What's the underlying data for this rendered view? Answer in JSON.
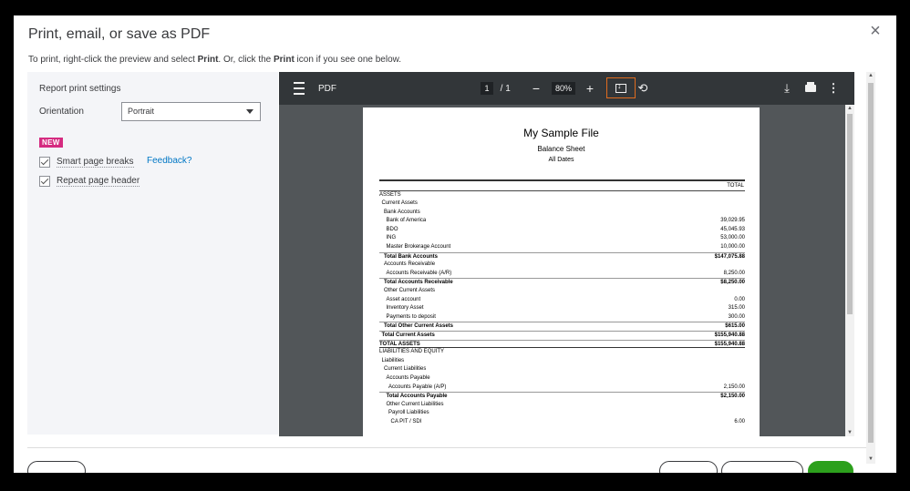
{
  "dialog": {
    "title": "Print, email, or save as PDF",
    "instructions": {
      "part1": "To print, right-click the preview and select ",
      "bold1": "Print",
      "part2": ". Or, click the ",
      "bold2": "Print",
      "part3": " icon if you see one below."
    },
    "close_glyph": "×"
  },
  "settings": {
    "title": "Report print settings",
    "orientation_label": "Orientation",
    "orientation_value": "Portrait",
    "new_badge": "NEW",
    "smart_page_breaks": {
      "label": "Smart page breaks",
      "checked": true
    },
    "repeat_page_header": {
      "label": "Repeat page header",
      "checked": true
    },
    "feedback_link": "Feedback?"
  },
  "viewer": {
    "label": "PDF",
    "current_page": "1",
    "separator": "/",
    "total_pages": "1",
    "zoom_minus": "−",
    "zoom": "80%",
    "zoom_plus": "+",
    "rotate_glyph": "⟲",
    "download_glyph": "⤓",
    "more_glyph": "⋮",
    "icons": [
      "menu-icon",
      "fit-page-icon",
      "rotate-icon",
      "download-icon",
      "print-icon",
      "more-icon"
    ]
  },
  "report": {
    "company": "My Sample File",
    "title": "Balance Sheet",
    "dates": "All Dates",
    "column_header": "TOTAL",
    "rows": [
      {
        "label": "ASSETS",
        "value": "",
        "indent": 0,
        "style": "normal"
      },
      {
        "label": "Current Assets",
        "value": "",
        "indent": 1,
        "style": "normal"
      },
      {
        "label": "Bank Accounts",
        "value": "",
        "indent": 2,
        "style": "normal"
      },
      {
        "label": "Bank of America",
        "value": "39,029.95",
        "indent": 3,
        "style": "normal"
      },
      {
        "label": "BDO",
        "value": "45,045.93",
        "indent": 3,
        "style": "normal"
      },
      {
        "label": "ING",
        "value": "53,000.00",
        "indent": 3,
        "style": "normal"
      },
      {
        "label": "Master Brokerage Account",
        "value": "10,000.00",
        "indent": 3,
        "style": "normal"
      },
      {
        "label": "Total Bank Accounts",
        "value": "$147,075.88",
        "indent": 2,
        "style": "total"
      },
      {
        "label": "Accounts Receivable",
        "value": "",
        "indent": 2,
        "style": "normal"
      },
      {
        "label": "Accounts Receivable (A/R)",
        "value": "8,250.00",
        "indent": 3,
        "style": "normal"
      },
      {
        "label": "Total Accounts Receivable",
        "value": "$8,250.00",
        "indent": 2,
        "style": "total"
      },
      {
        "label": "Other Current Assets",
        "value": "",
        "indent": 2,
        "style": "normal"
      },
      {
        "label": "Asset account",
        "value": "0.00",
        "indent": 3,
        "style": "normal"
      },
      {
        "label": "Inventory Asset",
        "value": "315.00",
        "indent": 3,
        "style": "normal"
      },
      {
        "label": "Payments to deposit",
        "value": "300.00",
        "indent": 3,
        "style": "normal"
      },
      {
        "label": "Total Other Current Assets",
        "value": "$615.00",
        "indent": 2,
        "style": "total"
      },
      {
        "label": "Total Current Assets",
        "value": "$155,940.88",
        "indent": 1,
        "style": "total"
      },
      {
        "label": "TOTAL ASSETS",
        "value": "$155,940.88",
        "indent": 0,
        "style": "grand"
      },
      {
        "label": "LIABILITIES AND EQUITY",
        "value": "",
        "indent": 0,
        "style": "normal"
      },
      {
        "label": "Liabilities",
        "value": "",
        "indent": 1,
        "style": "normal"
      },
      {
        "label": "Current Liabilities",
        "value": "",
        "indent": 2,
        "style": "normal"
      },
      {
        "label": "Accounts Payable",
        "value": "",
        "indent": 3,
        "style": "normal"
      },
      {
        "label": "Accounts Payable (A/P)",
        "value": "2,150.00",
        "indent": 4,
        "style": "normal"
      },
      {
        "label": "Total Accounts Payable",
        "value": "$2,150.00",
        "indent": 3,
        "style": "total"
      },
      {
        "label": "Other Current Liabilities",
        "value": "",
        "indent": 3,
        "style": "normal"
      },
      {
        "label": "Payroll Liabilities",
        "value": "",
        "indent": 4,
        "style": "normal"
      },
      {
        "label": "CA PIT / SDI",
        "value": "6.00",
        "indent": 5,
        "style": "normal"
      }
    ]
  },
  "colors": {
    "highlight_border": "#e06c1f",
    "new_badge": "#d52b80",
    "link": "#0077c5",
    "primary_button": "#2ca01c"
  }
}
